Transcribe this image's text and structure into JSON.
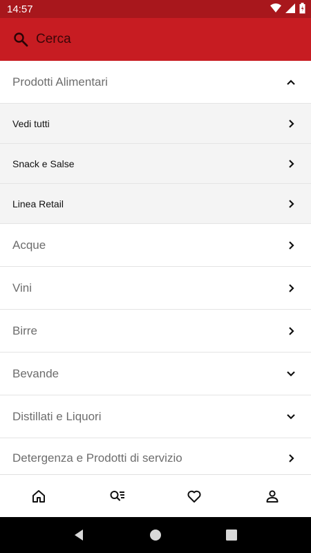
{
  "status_bar": {
    "time": "14:57"
  },
  "search": {
    "label": "Cerca"
  },
  "categories": {
    "header": {
      "label": "Prodotti Alimentari",
      "state": "expanded"
    },
    "subitems": [
      {
        "label": "Vedi tutti"
      },
      {
        "label": "Snack e Salse"
      },
      {
        "label": "Linea Retail"
      }
    ],
    "items": [
      {
        "label": "Acque",
        "chevron": "right"
      },
      {
        "label": "Vini",
        "chevron": "right"
      },
      {
        "label": "Birre",
        "chevron": "right"
      },
      {
        "label": "Bevande",
        "chevron": "down"
      },
      {
        "label": "Distillati e Liquori",
        "chevron": "down"
      },
      {
        "label": "Detergenza e Prodotti di servizio",
        "chevron": "right"
      }
    ]
  },
  "bottom_nav": {
    "items": [
      "home-icon",
      "search-list-icon",
      "heart-icon",
      "person-icon"
    ]
  },
  "colors": {
    "accent": "#c71c22",
    "status": "#a8171c"
  }
}
